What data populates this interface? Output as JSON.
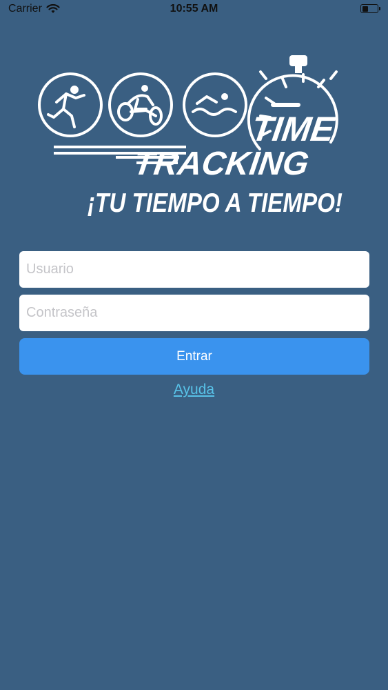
{
  "status_bar": {
    "carrier": "Carrier",
    "time": "10:55 AM",
    "wifi_icon": "wifi-icon",
    "battery_icon": "battery-icon"
  },
  "logo": {
    "line1": "TIME",
    "line2": "TRACKING",
    "tagline": "¡TU TIEMPO A TIEMPO!",
    "icons": [
      "runner-icon",
      "cyclist-icon",
      "swimmer-icon",
      "stopwatch-icon"
    ]
  },
  "login": {
    "username_placeholder": "Usuario",
    "password_placeholder": "Contraseña",
    "submit_label": "Entrar",
    "help_label": "Ayuda"
  },
  "colors": {
    "background": "#3a5f82",
    "button": "#3a93ee",
    "link": "#58c2e8"
  }
}
